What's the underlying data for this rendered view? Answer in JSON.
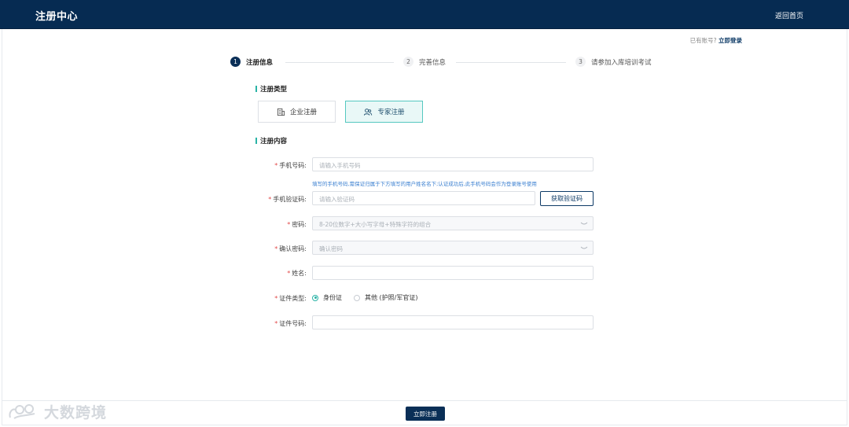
{
  "header": {
    "title": "注册中心",
    "back_label": "返回首页"
  },
  "login_hint": {
    "text": "已有账号?",
    "link": "立即登录"
  },
  "steps": [
    {
      "num": "1",
      "label": "注册信息",
      "state": "active"
    },
    {
      "num": "2",
      "label": "完善信息",
      "state": "todo"
    },
    {
      "num": "3",
      "label": "请参加入库培训考试",
      "state": "todo"
    }
  ],
  "register_type": {
    "title": "注册类型",
    "options": [
      {
        "label": "企业注册",
        "icon": "building-icon",
        "selected": false
      },
      {
        "label": "专家注册",
        "icon": "users-icon",
        "selected": true
      }
    ]
  },
  "register_content": {
    "title": "注册内容",
    "phone": {
      "label": "手机号码:",
      "placeholder": "请输入手机号码",
      "hint": "填写的手机号码,需保证归属于下方填写的用户姓名名下;认证成功后,此手机号码会作为登录账号使用"
    },
    "sms_code": {
      "label": "手机验证码:",
      "placeholder": "请输入验证码",
      "button": "获取验证码"
    },
    "password": {
      "label": "密码:",
      "placeholder": "8-20位数字+大小写字母+特殊字符的组合"
    },
    "confirm_password": {
      "label": "确认密码:",
      "placeholder": "确认密码"
    },
    "name": {
      "label": "姓名:",
      "placeholder": ""
    },
    "id_type": {
      "label": "证件类型:",
      "options": [
        "身份证",
        "其他 (护照/军官证)"
      ],
      "selected": "身份证"
    },
    "id_number": {
      "label": "证件号码:",
      "placeholder": ""
    }
  },
  "submit_label": "立即注册",
  "watermark": "大数跨境",
  "colors": {
    "header": "#062b52",
    "accent": "#2ab3a6",
    "required": "#e24b4b",
    "hint": "#3a7fd0"
  }
}
